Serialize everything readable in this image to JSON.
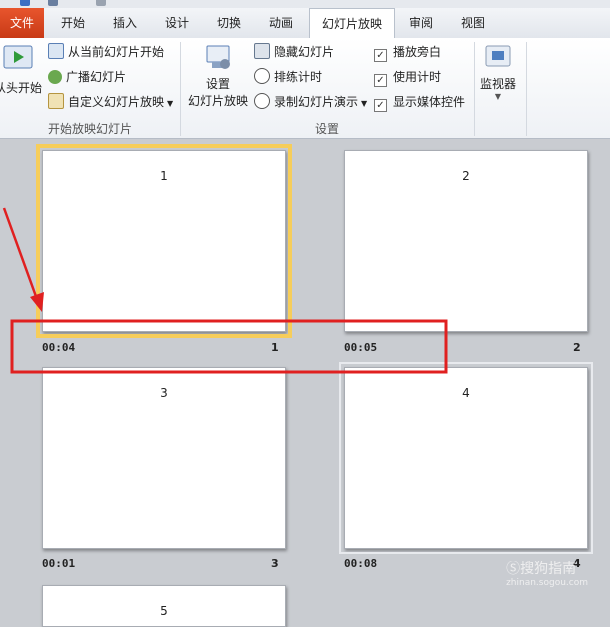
{
  "ribbon_tabs": [
    {
      "label": "文件"
    },
    {
      "label": "开始"
    },
    {
      "label": "插入"
    },
    {
      "label": "设计"
    },
    {
      "label": "切换"
    },
    {
      "label": "动画"
    },
    {
      "label": "幻灯片放映"
    },
    {
      "label": "审阅"
    },
    {
      "label": "视图"
    }
  ],
  "group_start": {
    "label": "开始放映幻灯片",
    "from_beginning": "从头开始",
    "from_current": "从当前幻灯片开始",
    "broadcast": "广播幻灯片",
    "custom": "自定义幻灯片放映"
  },
  "group_setup": {
    "label": "设置",
    "setup_line1": "设置",
    "setup_line2": "幻灯片放映",
    "hide_slide": "隐藏幻灯片",
    "rehearse": "排练计时",
    "record": "录制幻灯片演示",
    "play_narration": "播放旁白",
    "use_timings": "使用计时",
    "show_media": "显示媒体控件"
  },
  "group_monitors": {
    "label": "监视器"
  },
  "slides": [
    {
      "number": "1",
      "timing": "00:04",
      "index": "1"
    },
    {
      "number": "2",
      "timing": "00:05",
      "index": "2"
    },
    {
      "number": "3",
      "timing": "00:01",
      "index": "3"
    },
    {
      "number": "4",
      "timing": "00:08",
      "index": "4"
    },
    {
      "number": "5"
    }
  ],
  "watermark": {
    "brand": "搜狗指南",
    "url": "zhinan.sogou.com"
  },
  "colors": {
    "file_tab": "#d9461f",
    "selection_outline": "#f6cd5a",
    "annotation_red": "#e02020"
  }
}
